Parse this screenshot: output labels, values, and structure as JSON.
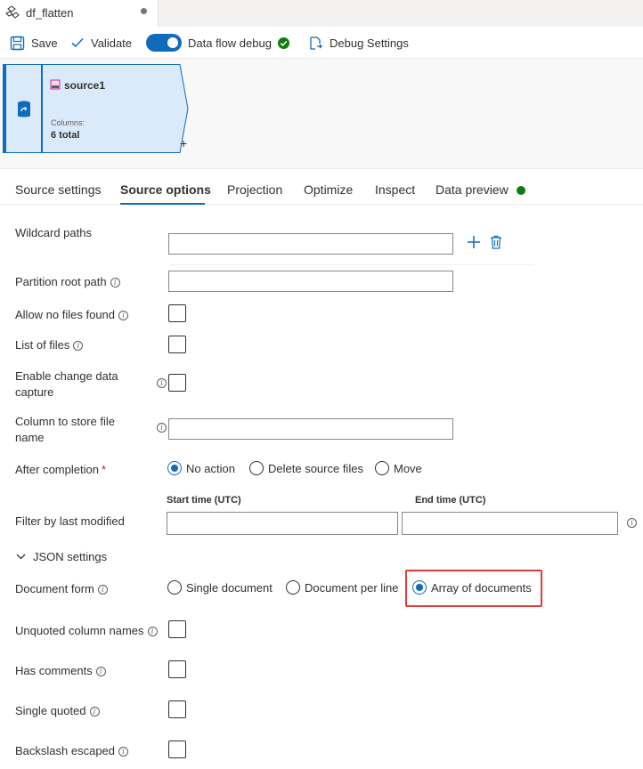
{
  "tab": {
    "title": "df_flatten"
  },
  "toolbar": {
    "save": "Save",
    "validate": "Validate",
    "debug": "Data flow debug",
    "debug_settings": "Debug Settings"
  },
  "node": {
    "title": "source1",
    "columns_label": "Columns:",
    "columns_value": "6 total",
    "add": "+"
  },
  "property_tabs": [
    {
      "label": "Source settings"
    },
    {
      "label": "Source options"
    },
    {
      "label": "Projection"
    },
    {
      "label": "Optimize"
    },
    {
      "label": "Inspect"
    },
    {
      "label": "Data preview"
    }
  ],
  "form": {
    "wildcard_paths": "Wildcard paths",
    "partition_root": "Partition root path",
    "allow_no_files": "Allow no files found",
    "list_of_files": "List of files",
    "enable_cdc": "Enable change data capture",
    "column_store": "Column to store file name",
    "after_completion": "After completion",
    "required_mark": "*",
    "after_options": [
      "No action",
      "Delete source files",
      "Move"
    ],
    "filter_modified": "Filter by last modified",
    "start_time": "Start time (UTC)",
    "end_time": "End time (UTC)",
    "json_settings": "JSON settings",
    "document_form": "Document form",
    "document_options": [
      "Single document",
      "Document per line",
      "Array of documents"
    ],
    "unquoted": "Unquoted column names",
    "has_comments": "Has comments",
    "single_quoted": "Single quoted",
    "backslash": "Backslash escaped"
  },
  "colors": {
    "accent": "#0f6cbd",
    "success": "#107c10",
    "highlight": "#e23b3b"
  }
}
